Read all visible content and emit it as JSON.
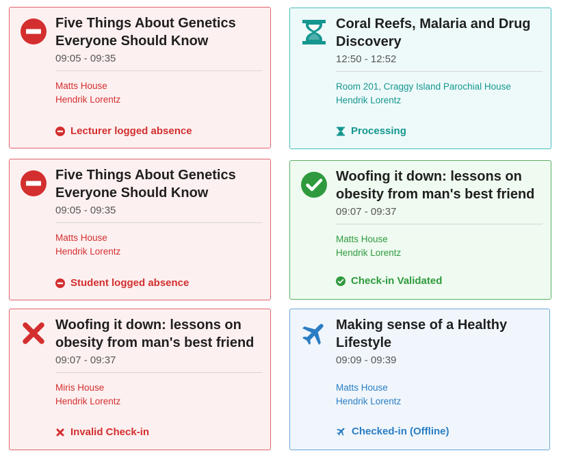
{
  "colors": {
    "red": "#d32f2f",
    "teal": "#15968f",
    "green": "#2e9a3d",
    "blue": "#2b7dc4"
  },
  "cards": [
    {
      "title": "Five Things About Genetics Everyone Should Know",
      "time": "09:05 - 09:35",
      "location": "Matts House",
      "lecturer": "Hendrik Lorentz",
      "status": "Lecturer logged absence",
      "icon": "no-entry-icon"
    },
    {
      "title": "Coral Reefs, Malaria and Drug Discovery",
      "time": "12:50 - 12:52",
      "location": "Room 201, Craggy Island Parochial House",
      "lecturer": "Hendrik Lorentz",
      "status": "Processing",
      "icon": "hourglass-icon"
    },
    {
      "title": "Five Things About Genetics Everyone Should Know",
      "time": "09:05 - 09:35",
      "location": "Matts House",
      "lecturer": "Hendrik Lorentz",
      "status": "Student logged absence",
      "icon": "no-entry-icon"
    },
    {
      "title": "Woofing it down: lessons on obesity from man's best friend",
      "time": "09:07 - 09:37",
      "location": "Matts House",
      "lecturer": "Hendrik Lorentz",
      "status": "Check-in Validated",
      "icon": "check-circle-icon"
    },
    {
      "title": "Woofing it down: lessons on obesity from man's best friend",
      "time": "09:07 - 09:37",
      "location": "Miris House",
      "lecturer": "Hendrik Lorentz",
      "status": "Invalid Check-in",
      "icon": "x-icon"
    },
    {
      "title": "Making sense of a Healthy Lifestyle",
      "time": "09:09 - 09:39",
      "location": "Matts House",
      "lecturer": "Hendrik Lorentz",
      "status": "Checked-in (Offline)",
      "icon": "airplane-icon"
    }
  ]
}
